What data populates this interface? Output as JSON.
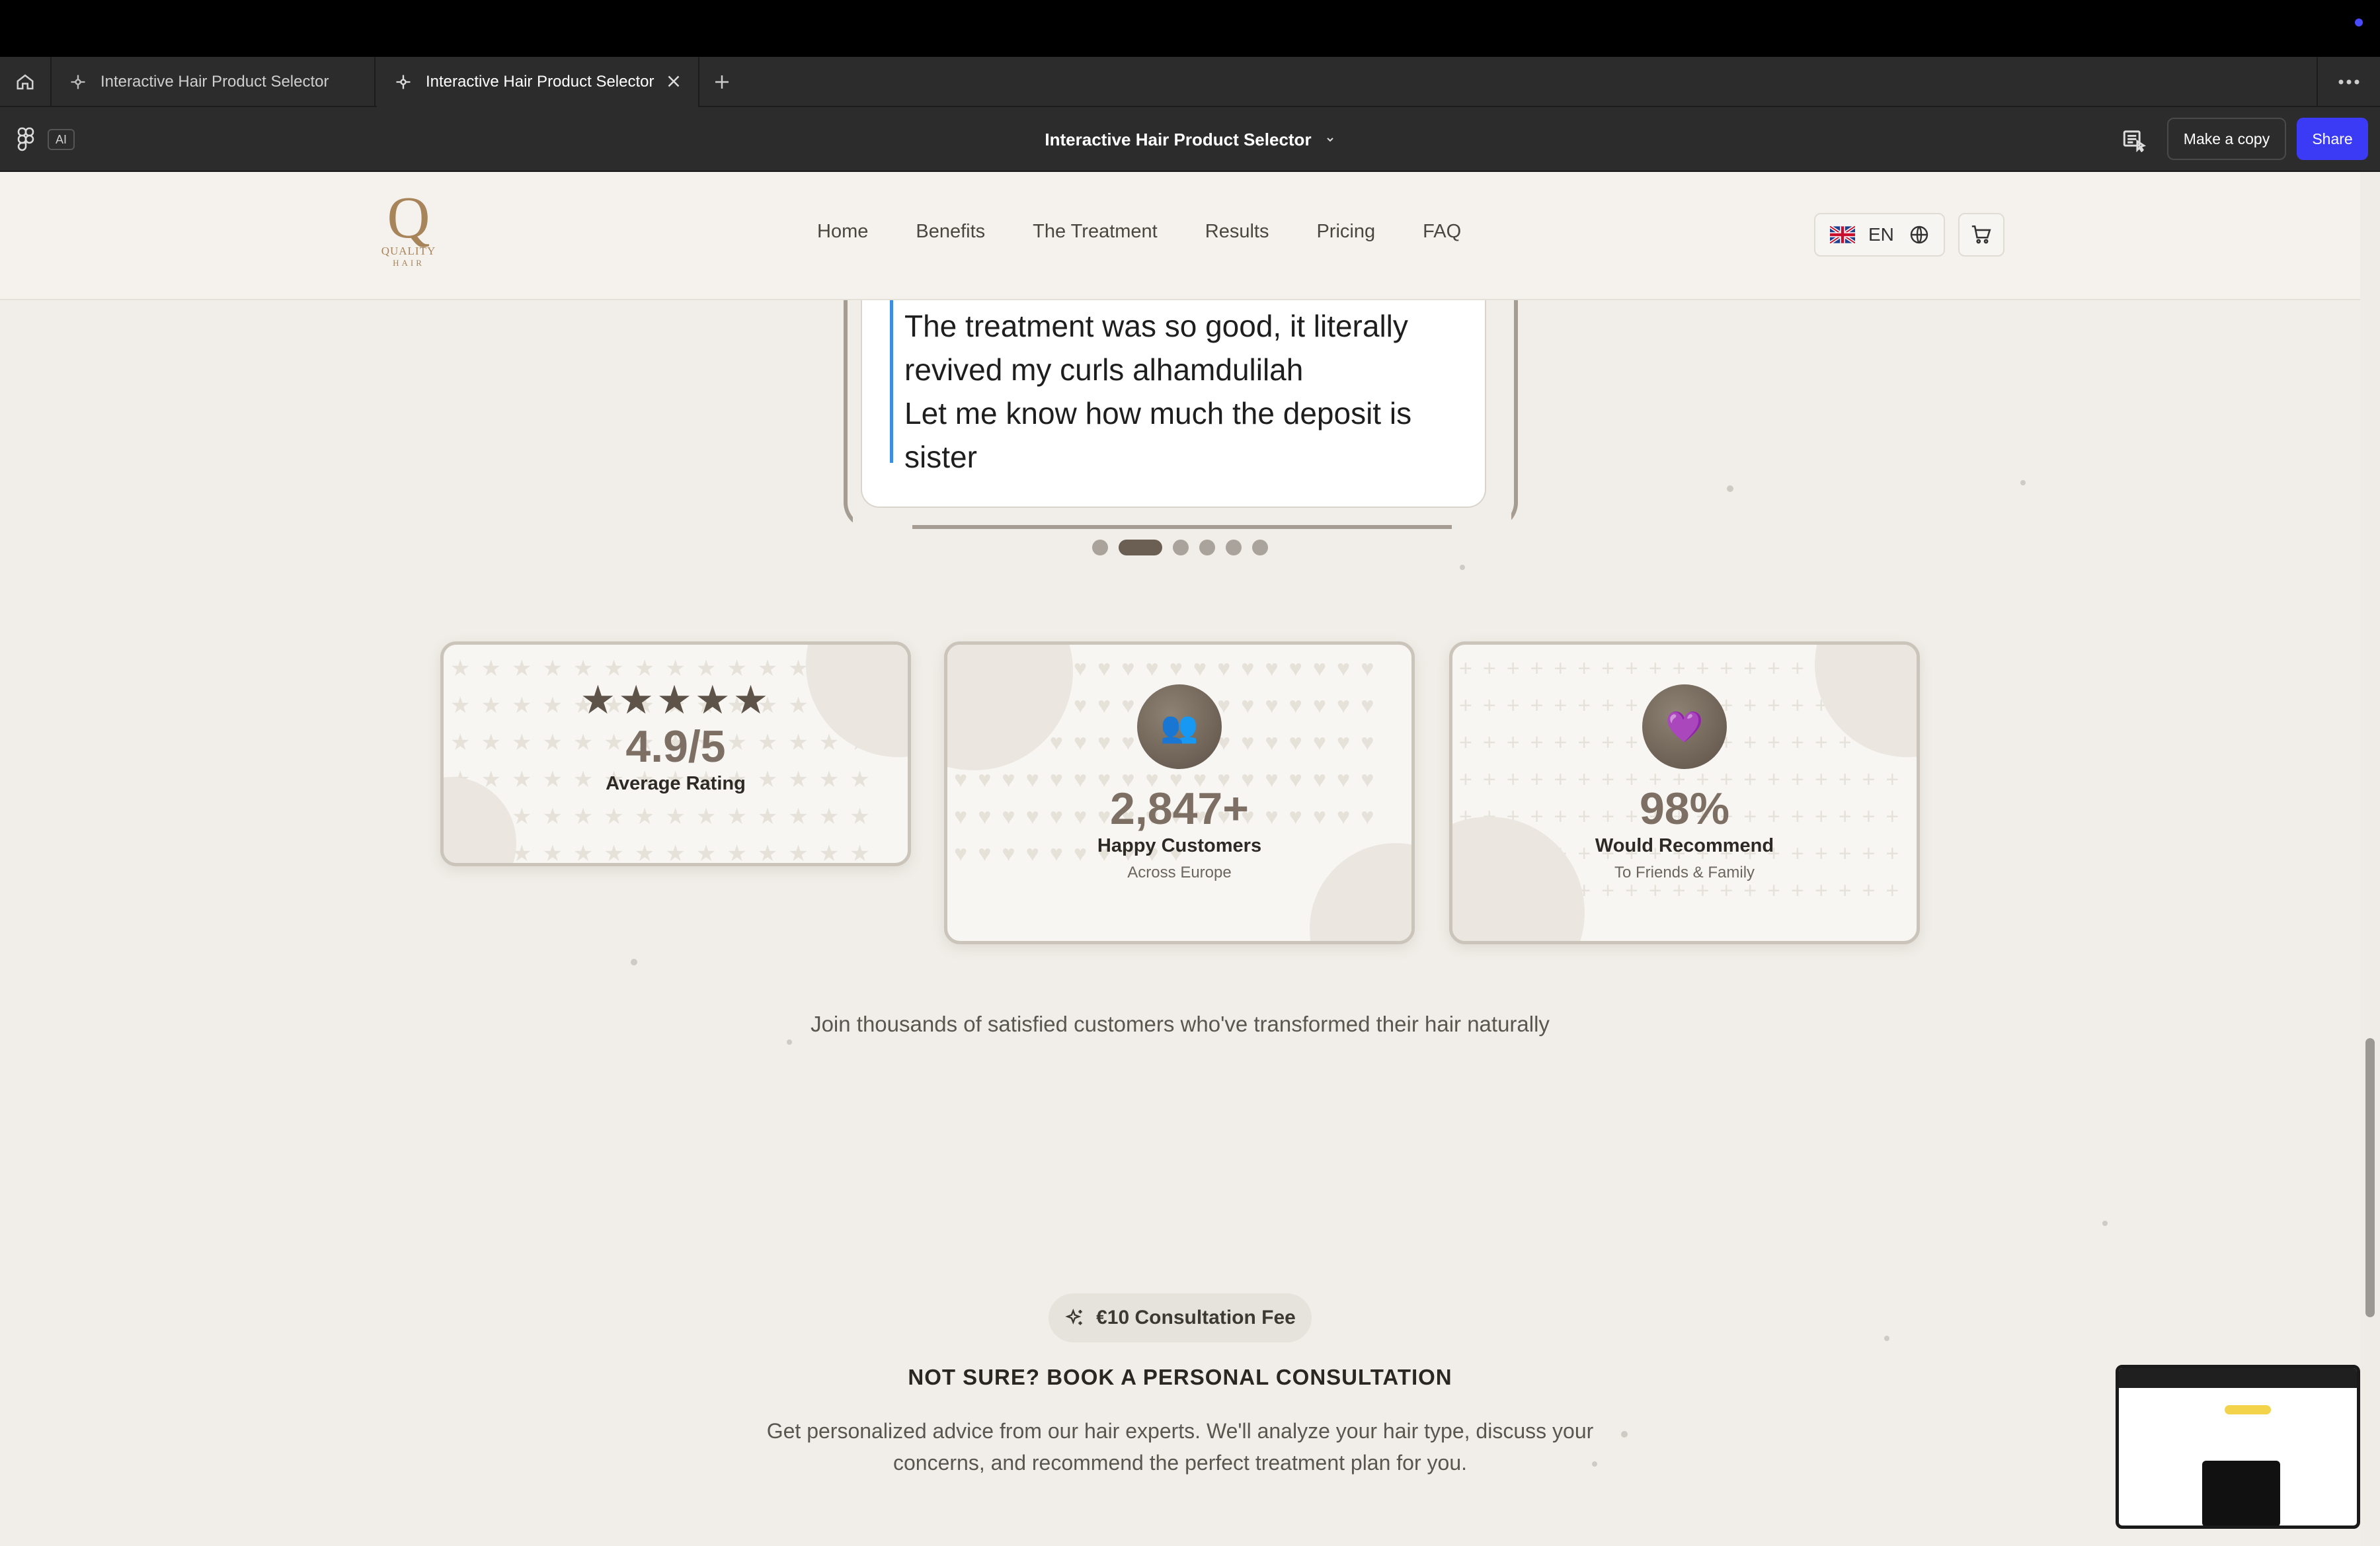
{
  "browser": {
    "tabs": [
      {
        "label": "Interactive Hair Product Selector",
        "active": false
      },
      {
        "label": "Interactive Hair Product Selector",
        "active": true
      }
    ],
    "ai_badge": "AI",
    "document_title": "Interactive Hair Product Selector",
    "make_copy_label": "Make a copy",
    "share_label": "Share",
    "accent_color": "#3b3bf5"
  },
  "site": {
    "logo": {
      "letter": "Q",
      "line1": "QUALITY",
      "line2": "HAIR"
    },
    "nav": [
      "Home",
      "Benefits",
      "The Treatment",
      "Results",
      "Pricing",
      "FAQ"
    ],
    "language": {
      "code": "EN",
      "flag": "uk-flag-icon"
    },
    "cart_icon": "cart-icon"
  },
  "testimonial": {
    "text_line1": "The treatment was so good, it literally",
    "text_line2": "revived my curls alhamdulilah",
    "text_line3": "Let me know how much the deposit is",
    "text_line4": "sister",
    "carousel_count": 6,
    "carousel_active_index": 1
  },
  "stats": {
    "rating": {
      "stars": "★★★★★",
      "value": "4.9/5",
      "label": "Average Rating"
    },
    "customers": {
      "icon": "👥",
      "value": "2,847+",
      "label": "Happy Customers",
      "sub": "Across Europe"
    },
    "recommend": {
      "icon": "💜",
      "value": "98%",
      "label": "Would Recommend",
      "sub": "To Friends & Family"
    }
  },
  "join_text": "Join thousands of satisfied customers who've transformed their hair naturally",
  "consultation": {
    "badge": "€10 Consultation Fee",
    "title": "NOT SURE? BOOK A PERSONAL CONSULTATION",
    "text": "Get personalized advice from our hair experts. We'll analyze your hair type, discuss your concerns, and recommend the perfect treatment plan for you."
  }
}
